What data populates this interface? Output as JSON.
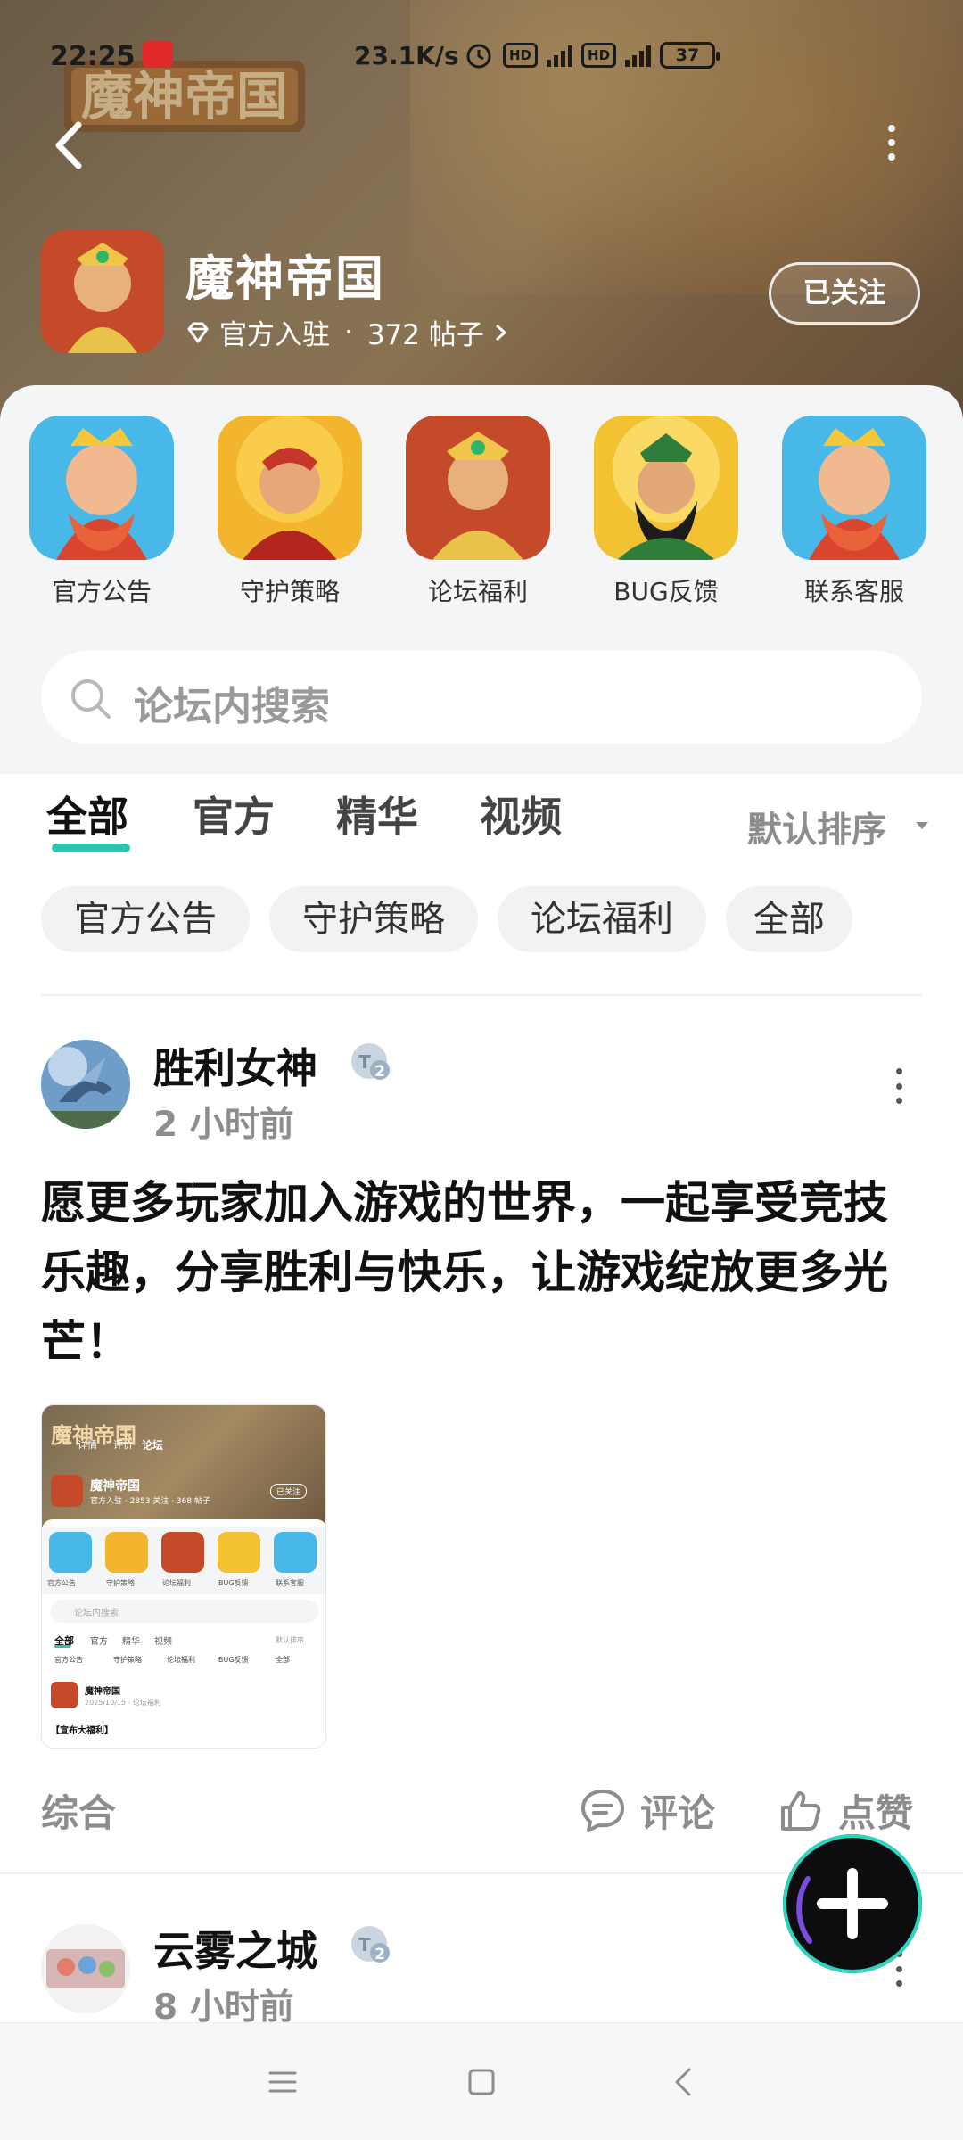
{
  "status_bar": {
    "time": "22:25",
    "net_speed": "23.1K/s",
    "hd1": "HD",
    "hd2": "HD",
    "battery": "37"
  },
  "header": {
    "logo_text": "魔神帝国",
    "game_name": "魔神帝国",
    "official_label": "官方入驻",
    "dot": "·",
    "post_count": "372 帖子",
    "follow_label": "已关注"
  },
  "shortcuts": [
    {
      "label": "官方公告",
      "icon": "announcement-hero-icon"
    },
    {
      "label": "守护策略",
      "icon": "strategy-hero-icon"
    },
    {
      "label": "论坛福利",
      "icon": "welfare-hero-icon"
    },
    {
      "label": "BUG反馈",
      "icon": "bug-feedback-hero-icon"
    },
    {
      "label": "联系客服",
      "icon": "support-hero-icon"
    }
  ],
  "search": {
    "placeholder": "论坛内搜索"
  },
  "tabs": [
    {
      "label": "全部",
      "active": true
    },
    {
      "label": "官方",
      "active": false
    },
    {
      "label": "精华",
      "active": false
    },
    {
      "label": "视频",
      "active": false
    }
  ],
  "sort": {
    "label": "默认排序"
  },
  "chips": [
    "官方公告",
    "守护策略",
    "论坛福利",
    "全部"
  ],
  "posts": [
    {
      "author": "胜利女神",
      "badge": "2",
      "time": "2 小时前",
      "text": "愿更多玩家加入游戏的世界，一起享受竞技乐趣，分享胜利与快乐，让游戏绽放更多光芒！",
      "category": "综合",
      "comment_label": "评论",
      "like_label": "点赞",
      "thumbnail": {
        "title": "魔神帝国",
        "meta": "官方入驻 · 2853 关注 · 368 帖子",
        "follow": "已关注",
        "tabs_top": [
          "详情",
          "评价",
          "论坛"
        ],
        "icons": [
          "官方公告",
          "守护策略",
          "论坛福利",
          "BUG反馈",
          "联系客服"
        ],
        "search": "论坛内搜索",
        "tabs": [
          "全部",
          "官方",
          "精华",
          "视频"
        ],
        "sort": "默认排序",
        "chips": [
          "官方公告",
          "守护策略",
          "论坛福利",
          "BUG反馈",
          "全部"
        ],
        "post_author": "魔神帝国",
        "post_date": "2025/10/15 · 论坛福利",
        "post_preview": "【宣布大福利】"
      }
    },
    {
      "author": "云雾之城",
      "badge": "2",
      "time": "8 小时前"
    }
  ],
  "colors": {
    "accent": "#2ec5b0",
    "muted": "#8d8d8d",
    "header_brown": "#9a8566"
  }
}
